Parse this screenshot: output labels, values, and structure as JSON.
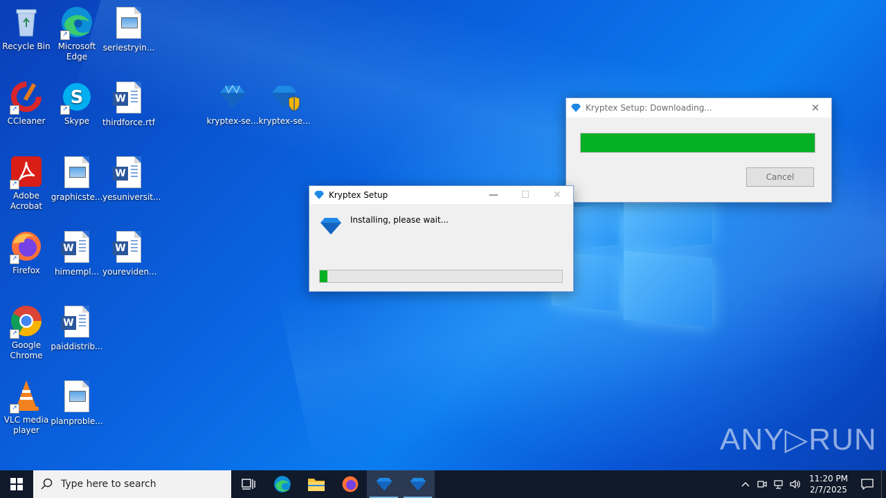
{
  "desktop_icons": [
    {
      "label": "Recycle Bin"
    },
    {
      "label": "Microsoft Edge"
    },
    {
      "label": "seriestryin..."
    },
    {
      "label": "CCleaner"
    },
    {
      "label": "Skype"
    },
    {
      "label": "thirdforce.rtf"
    },
    {
      "label": "kryptex-se..."
    },
    {
      "label": "kryptex-se..."
    },
    {
      "label": "Adobe Acrobat"
    },
    {
      "label": "graphicste..."
    },
    {
      "label": "yesuniversit..."
    },
    {
      "label": "Firefox"
    },
    {
      "label": "himempl..."
    },
    {
      "label": "youreviden..."
    },
    {
      "label": "Google Chrome"
    },
    {
      "label": "paiddistrib..."
    },
    {
      "label": "VLC media player"
    },
    {
      "label": "planproble..."
    }
  ],
  "download_window": {
    "title": "Kryptex Setup: Downloading...",
    "progress_fraction": 1.0,
    "cancel_label": "Cancel"
  },
  "setup_window": {
    "title": "Kryptex Setup",
    "message": "Installing, please wait...",
    "progress_fraction": 0.03,
    "minimize_glyph": "—",
    "maximize_glyph": "☐",
    "close_glyph": "✕"
  },
  "taskbar": {
    "search_placeholder": "Type here to search",
    "time": "11:20 PM",
    "date": "2/7/2025"
  },
  "watermark": {
    "text": "ANY▷RUN"
  },
  "colors": {
    "progress_green": "#06b025",
    "kryptex_blue": "#1e88e5",
    "taskbar_bg": "#101a2a"
  }
}
